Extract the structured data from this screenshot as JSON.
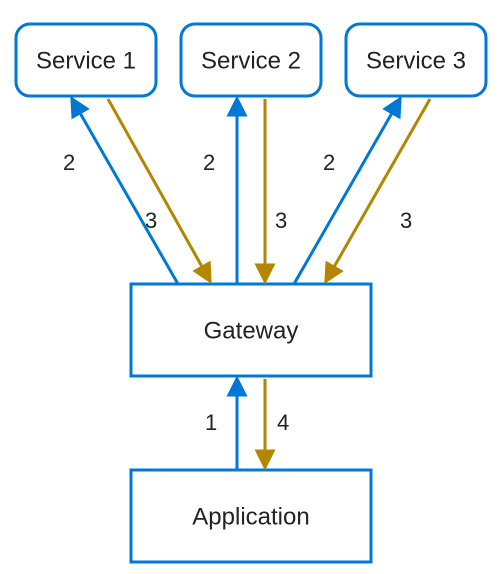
{
  "colors": {
    "blue": "#0078d4",
    "gold": "#b38600",
    "text": "#222222",
    "background": "#ffffff"
  },
  "nodes": {
    "service1": {
      "label": "Service 1"
    },
    "service2": {
      "label": "Service 2"
    },
    "service3": {
      "label": "Service 3"
    },
    "gateway": {
      "label": "Gateway"
    },
    "application": {
      "label": "Application"
    }
  },
  "edges": {
    "app_to_gateway": {
      "label": "1"
    },
    "gateway_to_svc1": {
      "label": "2"
    },
    "gateway_to_svc2": {
      "label": "2"
    },
    "gateway_to_svc3": {
      "label": "2"
    },
    "svc1_to_gateway": {
      "label": "3"
    },
    "svc2_to_gateway": {
      "label": "3"
    },
    "svc3_to_gateway": {
      "label": "3"
    },
    "gateway_to_app": {
      "label": "4"
    }
  }
}
